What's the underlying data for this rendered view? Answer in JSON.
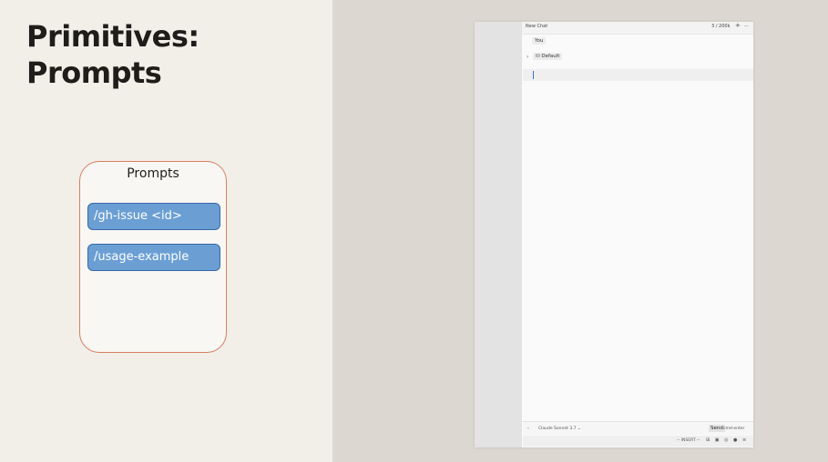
{
  "slide": {
    "title_line1": "Primitives:",
    "title_line2": "Prompts",
    "panel_title": "Prompts",
    "prompts": [
      "/gh-issue <id>",
      "/usage-example"
    ]
  },
  "chat": {
    "window_title": "New Chat",
    "token_count": "3 / 200k",
    "plus_icon": "+",
    "more_icon": "···",
    "you_label": "You",
    "expand_icon": "›",
    "default_label": "⛁ Default",
    "footer_arrow": "‹",
    "model_name": "Claude Sonnet 3.7 ⌄",
    "send_label": "Send",
    "send_hint": "cmd-enter",
    "mode": "-- INSERT --",
    "status_icons": "⊞ ▣ ◎ ● ≡"
  }
}
